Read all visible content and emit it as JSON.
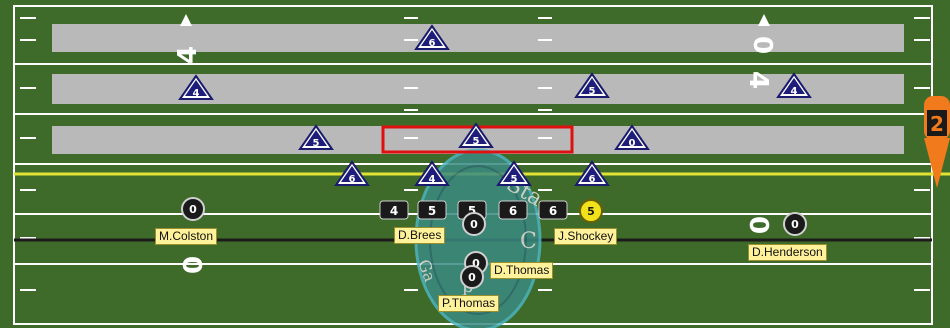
{
  "game": {
    "field_colors": {
      "grass": "#3f6b2a",
      "stripe": "#b9b9b9",
      "line": "#ffffff",
      "first_down_line": "#e1e334",
      "scrimmage_line": "#1b1b1b",
      "highlight": "#e01010"
    },
    "yard_numbers": [
      "4",
      "0",
      "4",
      "0",
      "0"
    ],
    "down_marker": {
      "number": "2",
      "color": "#f07a1c"
    },
    "center_logo_text": [
      "Sta",
      "Ga",
      "C",
      "p"
    ],
    "defenders": [
      {
        "number": "6",
        "role": "deep-safety"
      },
      {
        "number": "4",
        "role": "linebacker"
      },
      {
        "number": "5",
        "role": "linebacker"
      },
      {
        "number": "4",
        "role": "linebacker"
      },
      {
        "number": "5",
        "role": "linebacker"
      },
      {
        "number": "5",
        "role": "linebacker-selected"
      },
      {
        "number": "0",
        "role": "linebacker"
      },
      {
        "number": "6",
        "role": "lineman"
      },
      {
        "number": "4",
        "role": "lineman"
      },
      {
        "number": "5",
        "role": "lineman"
      },
      {
        "number": "6",
        "role": "lineman"
      }
    ],
    "linemen": [
      "4",
      "5",
      "5",
      "6",
      "6"
    ],
    "offense": [
      {
        "name": "M.Colston",
        "number": "0"
      },
      {
        "name": "D.Brees",
        "number": "0"
      },
      {
        "name": "J.Shockey",
        "number": "5"
      },
      {
        "name": "D.Thomas",
        "number": "0"
      },
      {
        "name": "P.Thomas",
        "number": "0"
      },
      {
        "name": "D.Henderson",
        "number": "0"
      }
    ]
  }
}
